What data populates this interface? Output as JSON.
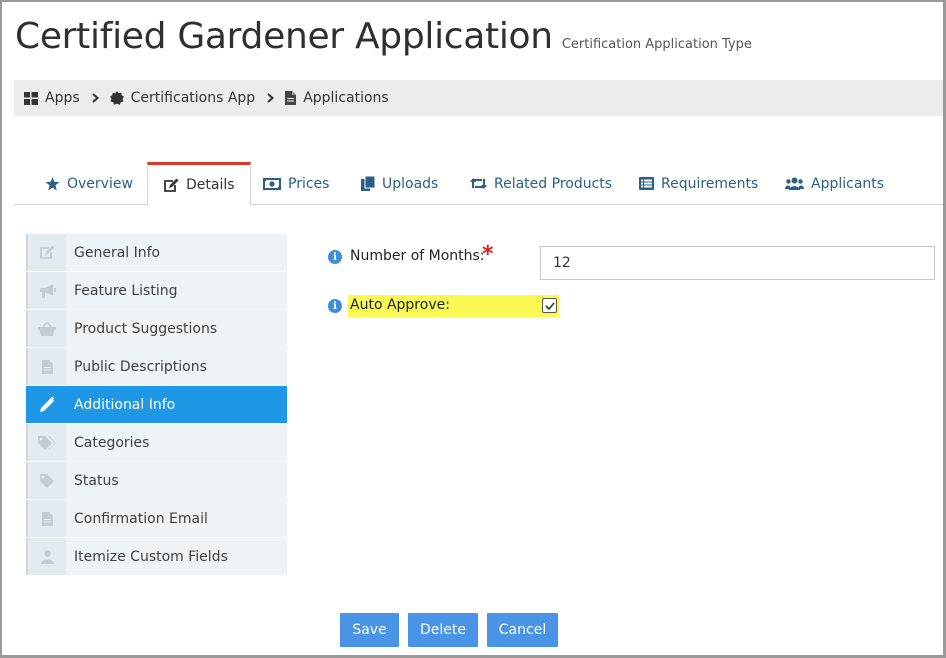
{
  "header": {
    "title": "Certified Gardener Application",
    "subtitle": "Certification Application Type"
  },
  "breadcrumb": [
    {
      "label": "Apps",
      "icon": "grid-icon"
    },
    {
      "label": "Certifications App",
      "icon": "badge-icon"
    },
    {
      "label": "Applications",
      "icon": "file-icon"
    }
  ],
  "tabs": [
    {
      "label": "Overview",
      "icon": "star-icon"
    },
    {
      "label": "Details",
      "icon": "edit-icon",
      "active": true
    },
    {
      "label": "Prices",
      "icon": "money-icon"
    },
    {
      "label": "Uploads",
      "icon": "files-icon"
    },
    {
      "label": "Related Products",
      "icon": "retweet-icon"
    },
    {
      "label": "Requirements",
      "icon": "list-icon"
    },
    {
      "label": "Applicants",
      "icon": "users-icon"
    }
  ],
  "sidebar": {
    "items": [
      {
        "label": "General Info",
        "icon": "edit-icon"
      },
      {
        "label": "Feature Listing",
        "icon": "bullhorn-icon"
      },
      {
        "label": "Product Suggestions",
        "icon": "basket-icon"
      },
      {
        "label": "Public Descriptions",
        "icon": "file-icon"
      },
      {
        "label": "Additional Info",
        "icon": "pencil-icon",
        "active": true
      },
      {
        "label": "Categories",
        "icon": "tags-icon"
      },
      {
        "label": "Status",
        "icon": "tag-icon"
      },
      {
        "label": "Confirmation Email",
        "icon": "file-icon"
      },
      {
        "label": "Itemize Custom Fields",
        "icon": "user-icon"
      }
    ]
  },
  "form": {
    "months_label": "Number of Months:",
    "months_required": "*",
    "months_value": "12",
    "auto_approve_label": "Auto Approve:",
    "auto_approve_checked": true,
    "info_glyph": "i"
  },
  "buttons": {
    "save": "Save",
    "delete": "Delete",
    "cancel": "Cancel"
  },
  "colors": {
    "accent": "#1e98e6",
    "button": "#4a94e8",
    "tab_active_border": "#d9382b",
    "highlight": "#fafa55",
    "link": "#2a5f86"
  }
}
